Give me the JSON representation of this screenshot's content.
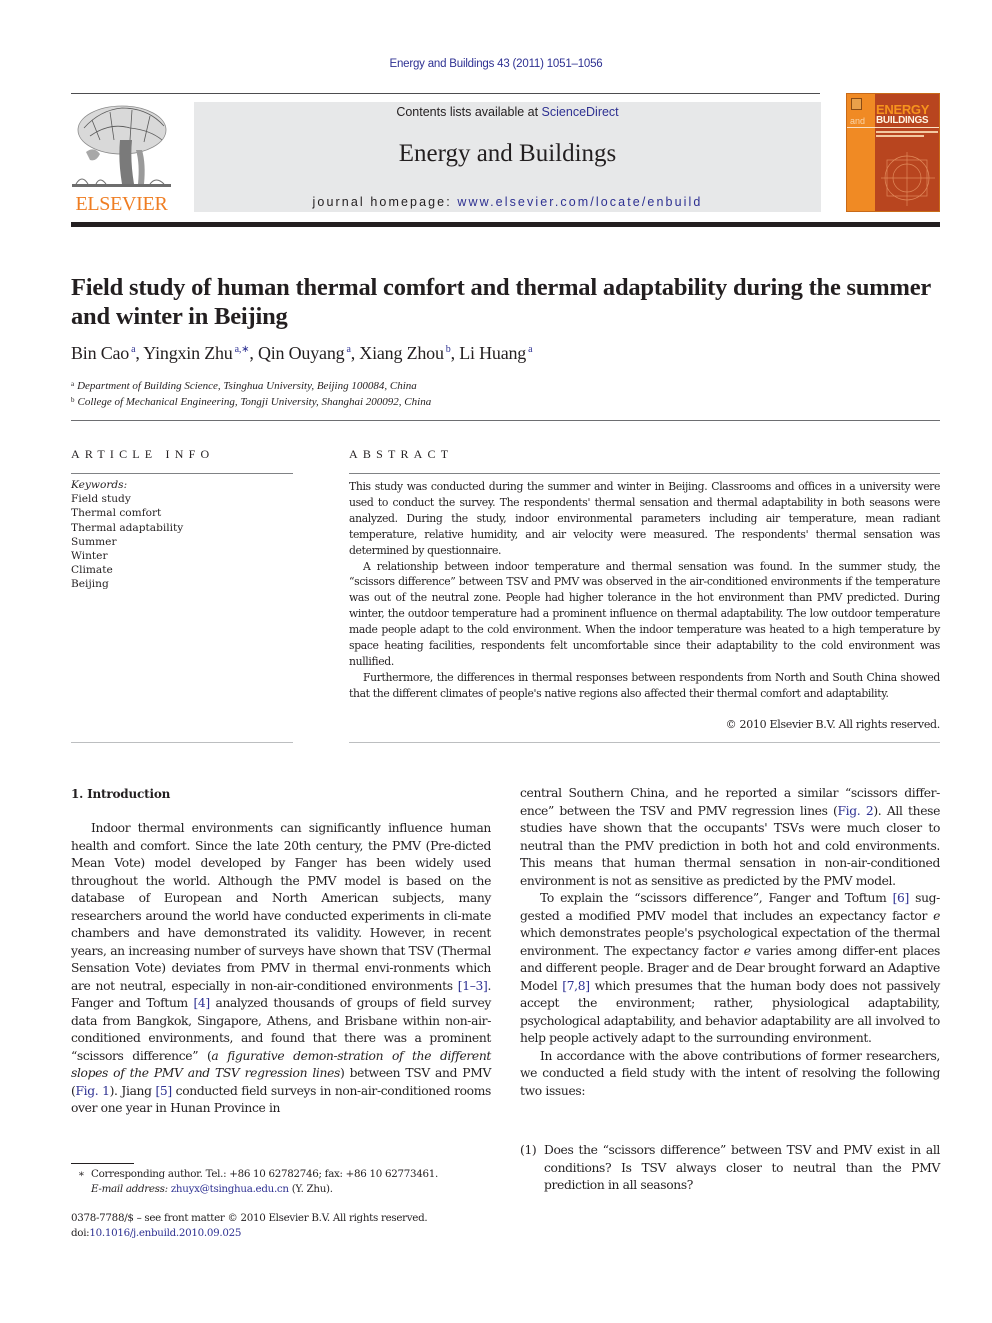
{
  "header": {
    "journal_ref": "Energy and Buildings 43 (2011) 1051–1056",
    "contents_prefix": "Contents lists available at ",
    "contents_link": "ScienceDirect",
    "journal_title": "Energy and Buildings",
    "homepage_prefix": "journal homepage: ",
    "homepage_url": "www.elsevier.com/locate/enbuild",
    "publisher_logo_text": "ELSEVIER",
    "cover": {
      "line1": "ENERGY",
      "line2_prefix": "and",
      "line2": "BUILDINGS"
    },
    "colors": {
      "link_blue": "#2e3192",
      "elsevier_orange": "#ef7d22",
      "cover_orange": "#f08a24",
      "cover_dark": "#b8451f",
      "masthead_gray": "#e7e8e9"
    }
  },
  "article": {
    "title": "Field study of human thermal comfort and thermal adaptability during the summer and winter in Beijing",
    "authors": [
      {
        "name": "Bin Cao",
        "sup": "a"
      },
      {
        "name": "Yingxin Zhu",
        "sup": "a,∗"
      },
      {
        "name": "Qin Ouyang",
        "sup": "a"
      },
      {
        "name": "Xiang Zhou",
        "sup": "b"
      },
      {
        "name": "Li Huang",
        "sup": "a"
      }
    ],
    "affiliations": [
      {
        "mark": "a",
        "text": "Department of Building Science, Tsinghua University, Beijing 100084, China"
      },
      {
        "mark": "b",
        "text": "College of Mechanical Engineering, Tongji University, Shanghai 200092, China"
      }
    ]
  },
  "article_info": {
    "heading": "ARTICLE INFO",
    "keywords_label": "Keywords:",
    "keywords": [
      "Field study",
      "Thermal comfort",
      "Thermal adaptability",
      "Summer",
      "Winter",
      "Climate",
      "Beijing"
    ]
  },
  "abstract": {
    "heading": "ABSTRACT",
    "paragraphs": [
      "This study was conducted during the summer and winter in Beijing. Classrooms and offices in a university were used to conduct the survey. The respondents' thermal sensation and thermal adaptability in both seasons were analyzed. During the study, indoor environmental parameters including air temperature, mean radiant temperature, relative humidity, and air velocity were measured. The respondents' thermal sensation was determined by questionnaire.",
      "A relationship between indoor temperature and thermal sensation was found. In the summer study, the “scissors difference” between TSV and PMV was observed in the air-conditioned environments if the temperature was out of the neutral zone. People had higher tolerance in the hot environment than PMV predicted. During winter, the outdoor temperature had a prominent influence on thermal adaptability. The low outdoor temperature made people adapt to the cold environment. When the indoor temperature was heated to a high temperature by space heating facilities, respondents felt uncomfortable since their adaptability to the cold environment was nullified.",
      "Furthermore, the differences in thermal responses between respondents from North and South China showed that the different climates of people's native regions also affected their thermal comfort and adaptability."
    ],
    "copyright": "© 2010 Elsevier B.V. All rights reserved."
  },
  "introduction": {
    "heading": "1.  Introduction",
    "left_p1": {
      "t1": "Indoor thermal environments can significantly influence human health and comfort. Since the late 20th century, the PMV (Pre-dicted Mean Vote) model developed by Fanger has been widely used throughout the world. Although the PMV model is based on the database of European and North American subjects, many researchers around the world have conducted experiments in cli-mate chambers and have demonstrated its validity. However, in recent years, an increasing number of surveys have shown that TSV (Thermal Sensation Vote) deviates from PMV in thermal envi-ronments which are not neutral, especially in non-air-conditioned environments ",
      "ref1": "[1–3]",
      "t2": ". Fanger and Toftum ",
      "ref2": "[4]",
      "t3": " analyzed thousands of groups of field survey data from Bangkok, Singapore, Athens, and Brisbane within non-air-conditioned environments, and found that there was a prominent “scissors difference” (",
      "italic": "a figurative demon-stration of the different slopes of the PMV and TSV regression lines",
      "t4": ") between TSV and PMV (",
      "ref3": "Fig. 1",
      "t5": "). Jiang ",
      "ref4": "[5]",
      "t6": " conducted field surveys in non-air-conditioned rooms over one year in Hunan Province in"
    },
    "right_p1": {
      "t1": "central Southern China, and he reported a similar “scissors differ-ence” between the TSV and PMV regression lines (",
      "ref1": "Fig. 2",
      "t2": "). All these studies have shown that the occupants' TSVs were much closer to neutral than the PMV prediction in both hot and cold environments. This means that human thermal sensation in non-air-conditioned environment is not as sensitive as predicted by the PMV model."
    },
    "right_p2": {
      "t1": "To explain the “scissors difference”, Fanger and Toftum ",
      "ref1": "[6]",
      "t2": " sug-gested a modified PMV model that includes an expectancy factor ",
      "e1": "e",
      "t3": " which demonstrates people's psychological expectation of the thermal environment. The expectancy factor ",
      "e2": "e",
      "t4": " varies among differ-ent places and different people. Brager and de Dear brought forward an Adaptive Model ",
      "ref2": "[7,8]",
      "t5": " which presumes that the human body does not passively accept the environment; rather, physiological adaptability, psychological adaptability, and behavior adaptability are all involved to help people actively adapt to the surrounding environment."
    },
    "right_p3": "In accordance with the above contributions of former researchers, we conducted a field study with the intent of resolving the following two issues:",
    "issues": [
      {
        "num": "(1)",
        "text": "Does the “scissors difference” between TSV and PMV exist in all conditions? Is TSV always closer to neutral than the PMV prediction in all seasons?"
      }
    ]
  },
  "footnotes": {
    "star": "∗",
    "corresponding": "Corresponding author. Tel.: +86 10 62782746; fax: +86 10 62773461.",
    "email_label": "E-mail address:",
    "email": "zhuyx@tsinghua.edu.cn",
    "email_suffix": " (Y. Zhu).",
    "front_matter": "0378-7788/$ – see front matter © 2010 Elsevier B.V. All rights reserved.",
    "doi_prefix": "doi:",
    "doi": "10.1016/j.enbuild.2010.09.025"
  }
}
